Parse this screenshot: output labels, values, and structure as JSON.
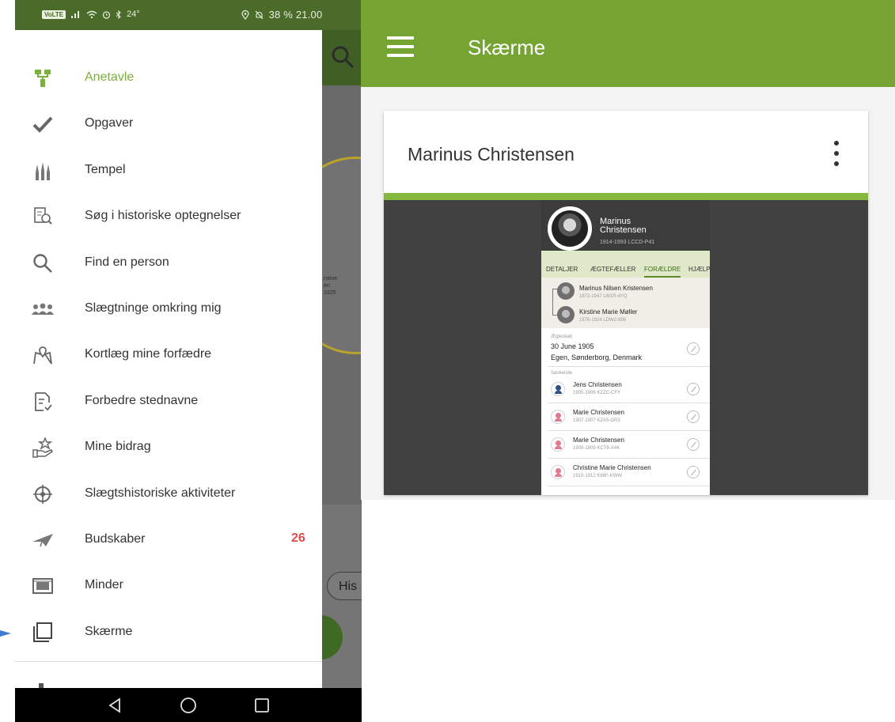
{
  "statusbar": {
    "volte": "VoLTE",
    "left": "24°",
    "right": "38 %  21.00"
  },
  "colors": {
    "brand_green": "#76a432",
    "active_nav": "#7bb03a",
    "badge_red": "#e14a4a"
  },
  "drawer": {
    "items": [
      {
        "label": "Anetavle",
        "icon": "family-tree-icon",
        "active": true
      },
      {
        "label": "Opgaver",
        "icon": "checkmark-icon"
      },
      {
        "label": "Tempel",
        "icon": "temple-icon"
      },
      {
        "label": "Søg i historiske optegnelser",
        "icon": "record-search-icon"
      },
      {
        "label": "Find en person",
        "icon": "search-icon"
      },
      {
        "label": "Slægtninge omkring mig",
        "icon": "relatives-icon"
      },
      {
        "label": "Kortlæg mine forfædre",
        "icon": "map-pin-icon"
      },
      {
        "label": "Forbedre stednavne",
        "icon": "document-check-icon"
      },
      {
        "label": "Mine bidrag",
        "icon": "hand-star-icon"
      },
      {
        "label": "Slægtshistoriske aktiviteter",
        "icon": "activities-icon"
      },
      {
        "label": "Budskaber",
        "icon": "paper-plane-icon",
        "badge": "26"
      },
      {
        "label": "Minder",
        "icon": "photo-frame-icon"
      },
      {
        "label": "Skærme",
        "icon": "screens-icon"
      }
    ]
  },
  "background_app": {
    "chip_label": "His",
    "fan_text": "rstine\nen\n1925"
  },
  "app": {
    "title": "Skærme",
    "card": {
      "person_name": "Marinus Christensen",
      "preview": {
        "header_name_line1": "Marinus",
        "header_name_line2": "Christensen",
        "header_meta": "1914-1993  LCCD-P41",
        "tabs": [
          "DETALJER",
          "ÆGTEFÆLLER",
          "FORÆLDRE",
          "HJÆLP"
        ],
        "selected_tab": "FORÆLDRE",
        "parents": [
          {
            "name": "Marinus Nilsen Kristensen",
            "meta": "1872-1947  LW1R-4YQ"
          },
          {
            "name": "Kirstine Marie Møller",
            "meta": "1876-1924  LDW2-896"
          }
        ],
        "marriage_label": "Ægteskab",
        "marriage_date": "30 June 1905",
        "marriage_place": "Egen, Sønderborg, Denmark",
        "siblings_label": "Søskende",
        "siblings": [
          {
            "name": "Jens Christensen",
            "meta": "1905-1906  KZZC-CFY",
            "sex": "male"
          },
          {
            "name": "Marie Christensen",
            "meta": "1907-1907  KZ4S-GR3",
            "sex": "female"
          },
          {
            "name": "Marie Christensen",
            "meta": "1909-1909  KCT8-X44",
            "sex": "female"
          },
          {
            "name": "Christine Marie Christensen",
            "meta": "1910-1912  K86F-KWW",
            "sex": "female"
          }
        ]
      }
    }
  }
}
